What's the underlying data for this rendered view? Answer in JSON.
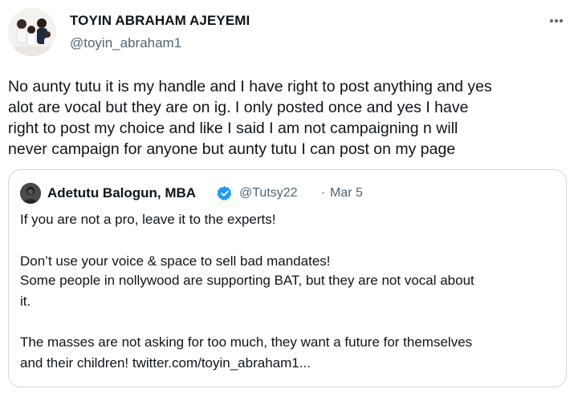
{
  "tweet": {
    "author_name": "TOYIN ABRAHAM AJEYEMI",
    "author_handle": "@toyin_abraham1",
    "more_label": "More",
    "text_lines": [
      "No aunty tutu it is my handle and I have right to post anything and yes",
      "alot are vocal but they are on ig. I only posted once and yes I have",
      "right to post my choice and like I said I am not campaigning n will",
      "never campaign for anyone but aunty tutu I can post on my page"
    ]
  },
  "quoted_tweet": {
    "author_name": "Adetutu Balogun, MBA",
    "author_handle": "@Tutsy22",
    "separator": "·",
    "date": "Mar 5",
    "text_lines": [
      "If you are not a pro, leave it to the experts!",
      "Don’t use your voice & space to sell bad mandates!",
      "Some people in nollywood are supporting BAT, but they are not vocal about",
      "it.",
      "The masses are not asking for too much, they want a future for themselves",
      "and their children! twitter.com/toyin_abraham1..."
    ]
  },
  "icons": {
    "more": "more-horizontal-icon",
    "verified": "verified-badge-icon"
  },
  "colors": {
    "primary_text": "#0f1419",
    "secondary_text": "#536471",
    "border": "#cfd9de",
    "verified_blue": "#1d9bf0"
  }
}
